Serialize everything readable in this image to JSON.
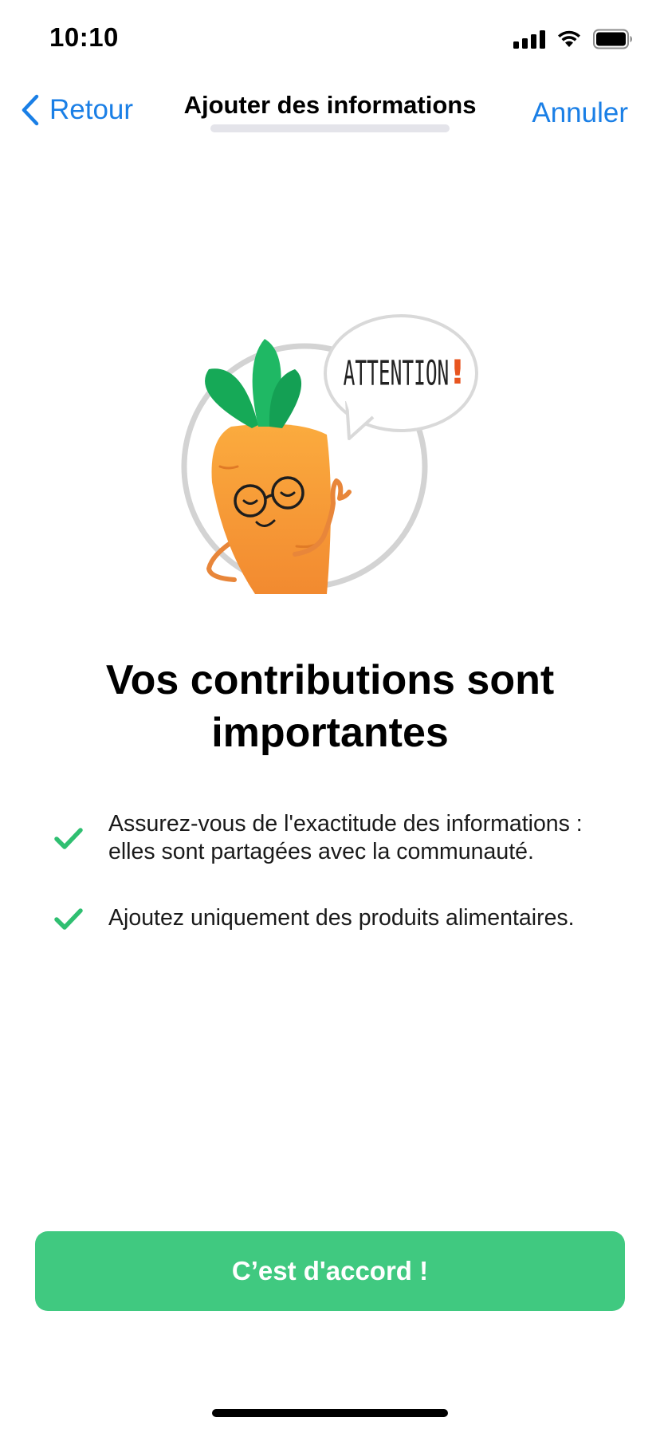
{
  "status_bar": {
    "time": "10:10",
    "icons": [
      "cellular-signal-icon",
      "wifi-icon",
      "battery-icon"
    ]
  },
  "nav": {
    "back_label": "Retour",
    "title": "Ajouter des informations",
    "cancel_label": "Annuler"
  },
  "illustration": {
    "bubble_text": "ATTENTION",
    "bubble_mark": "!",
    "icon": "carrot-mascot-illustration"
  },
  "headline": "Vos contributions sont importantes",
  "bullets": [
    {
      "text": "Assurez-vous de l'exactitude des informations : elles sont partagées avec la communauté.",
      "icon": "check-icon"
    },
    {
      "text": "Ajoutez uniquement des produits alimentaires.",
      "icon": "check-icon"
    }
  ],
  "cta": {
    "label": "C’est d'accord !"
  },
  "colors": {
    "accent_blue": "#1a7fe6",
    "primary_green": "#40c980",
    "check_green": "#2fbf71",
    "carrot_orange": "#f7a03a",
    "leaf_green": "#1fb05f"
  }
}
